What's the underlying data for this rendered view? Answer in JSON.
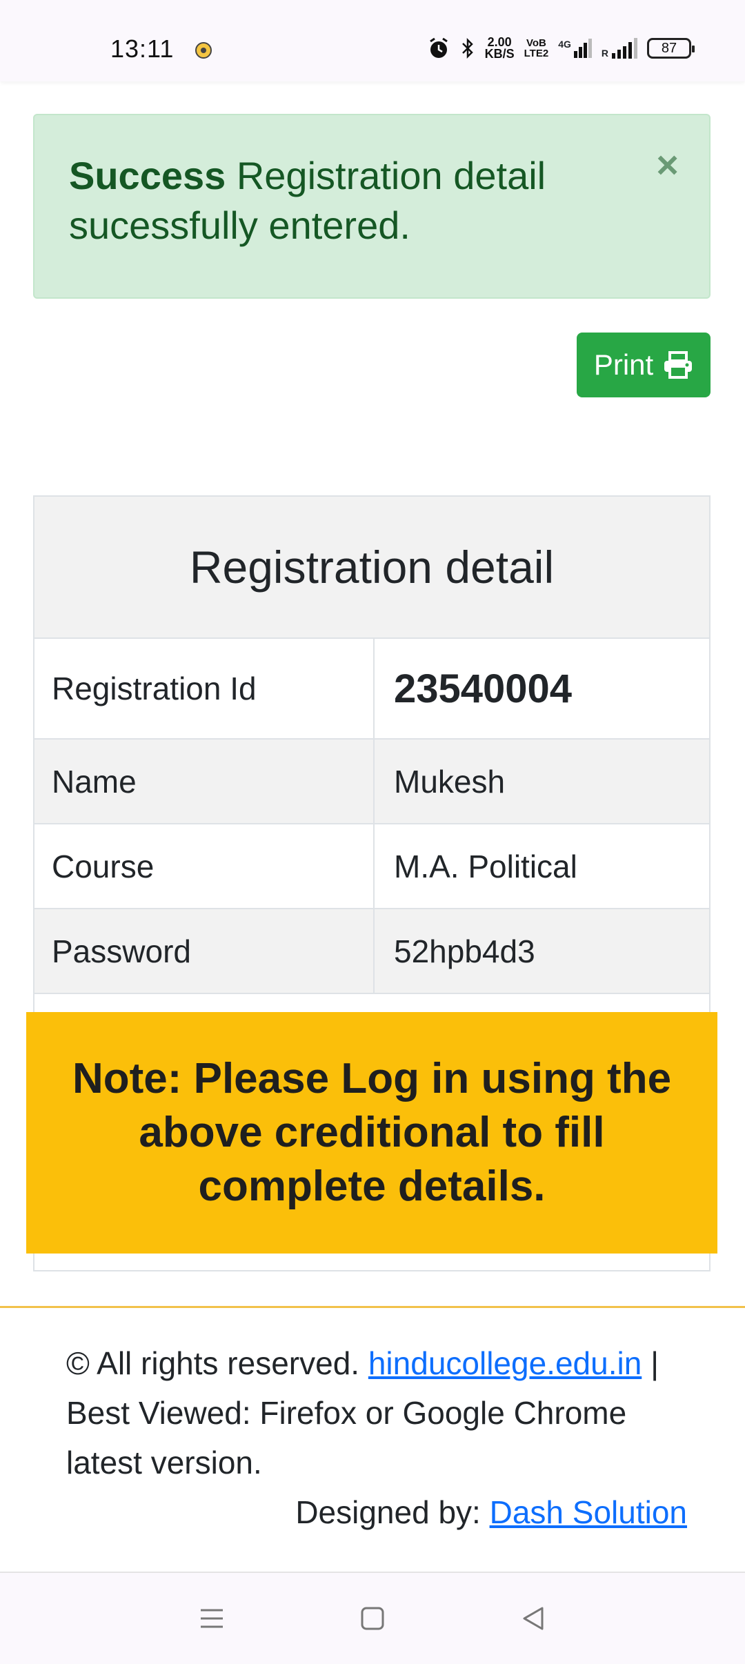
{
  "status_bar": {
    "time": "13:11",
    "net_speed_value": "2.00",
    "net_speed_unit": "KB/S",
    "volte_top": "VoB",
    "volte_bottom": "LTE2",
    "network_type": "4G",
    "battery": "87"
  },
  "alert": {
    "title": "Success",
    "message": "Registration detail sucessfully entered.",
    "close": "×"
  },
  "print_button": {
    "label": "Print"
  },
  "registration": {
    "heading": "Registration detail",
    "rows": [
      {
        "label": "Registration Id",
        "value": "23540004"
      },
      {
        "label": "Name",
        "value": "Mukesh"
      },
      {
        "label": "Course",
        "value": "M.A. Political"
      },
      {
        "label": "Password",
        "value": "52hpb4d3"
      }
    ]
  },
  "note": {
    "text": "Note: Please Log in using the above creditional to fill complete details."
  },
  "footer": {
    "rights": "© All rights reserved.",
    "site_link": "hinducollege.edu.in",
    "best_viewed": "| Best Viewed: Firefox or Google Chrome latest version.",
    "designed_by": "Designed by:",
    "designer_link": "Dash Solution"
  },
  "colors": {
    "alert_bg": "#d4edda",
    "alert_text": "#155724",
    "print_button": "#28a745",
    "note_bg": "#fbbf0a",
    "link": "#0d6efd"
  },
  "icons": [
    "alarm-icon",
    "bluetooth-icon",
    "signal-icon",
    "printer-icon",
    "menu-icon",
    "home-icon",
    "back-icon"
  ]
}
